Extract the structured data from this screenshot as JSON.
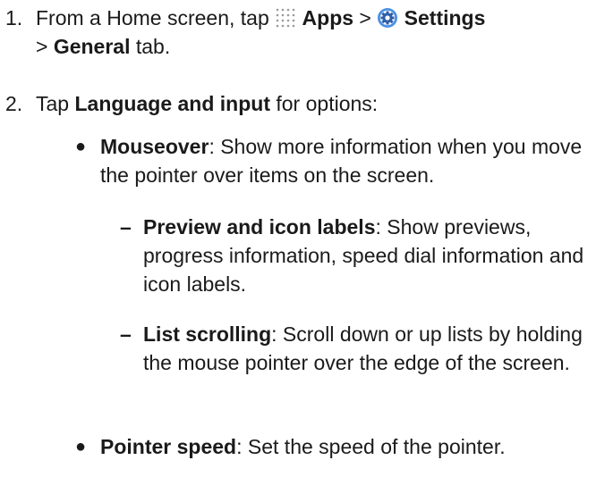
{
  "steps": [
    {
      "number": "1.",
      "prefix": "From a Home screen, tap ",
      "apps_label": "Apps",
      "sep1": " > ",
      "settings_label": "Settings",
      "line2_sep": "> ",
      "general_label": "General",
      "suffix": " tab."
    },
    {
      "number": "2.",
      "prefix": "Tap ",
      "language_label": "Language and input",
      "suffix": " for options:"
    }
  ],
  "options": {
    "mouseover": {
      "label": "Mouseover",
      "text": ": Show more information when you move the pointer over items on the screen.",
      "sub_items": [
        {
          "label": "Preview and icon labels",
          "text": ": Show previews, progress information, speed dial information and icon labels."
        },
        {
          "label": "List scrolling",
          "text": ": Scroll down or up lists by holding the mouse pointer over the edge of the screen."
        }
      ]
    },
    "pointer_speed": {
      "label": "Pointer speed",
      "text": ": Set the speed of the pointer."
    }
  },
  "icons": {
    "apps": "apps-grid-icon",
    "settings": "settings-gear-icon",
    "accent": "#1f6fd1"
  }
}
